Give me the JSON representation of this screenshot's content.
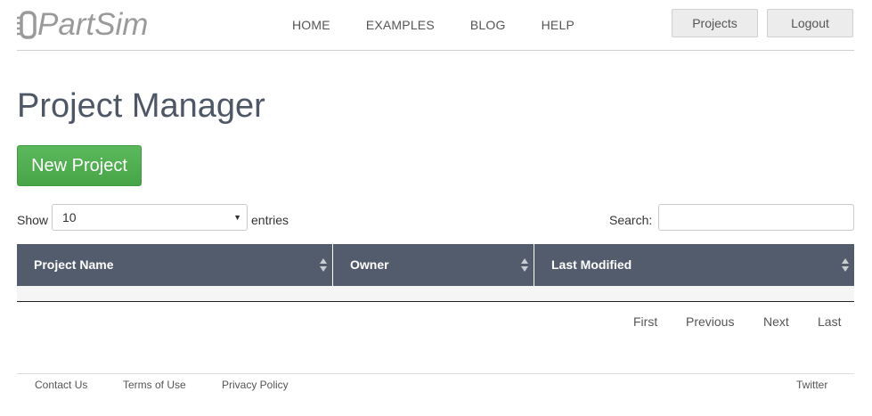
{
  "header": {
    "logo_text": "PartSim",
    "nav": [
      "HOME",
      "EXAMPLES",
      "BLOG",
      "HELP"
    ],
    "projects_button": "Projects",
    "logout_button": "Logout"
  },
  "main": {
    "title": "Project Manager",
    "new_project_button": "New Project"
  },
  "table_controls": {
    "show_label": "Show",
    "page_length": "10",
    "entries_label": "entries",
    "search_label": "Search:",
    "search_value": ""
  },
  "table": {
    "columns": [
      "Project Name",
      "Owner",
      "Last Modified"
    ],
    "rows": []
  },
  "pagination": {
    "first": "First",
    "previous": "Previous",
    "next": "Next",
    "last": "Last"
  },
  "footer": {
    "links": [
      "Contact Us",
      "Terms of Use",
      "Privacy Policy"
    ],
    "social": "Twitter"
  },
  "colors": {
    "table_header_bg": "#535c6c",
    "new_button_bg": "#4cae4c",
    "title_text": "#4e5766",
    "logo_gray": "#9a9a9a"
  }
}
